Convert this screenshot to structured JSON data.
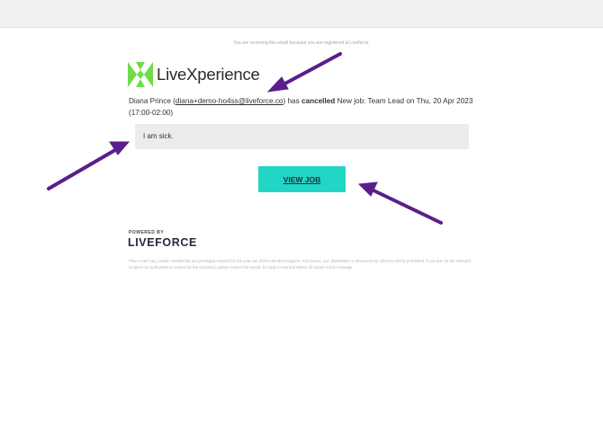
{
  "email": {
    "notice": "You are receiving this email because you are registered at Liveforce.",
    "logo_text": "LiveXperience",
    "message": {
      "name": "Diana Prince",
      "open_paren": " (",
      "email": "diana+demo-ho4ss@liveforce.co",
      "middle": ") has ",
      "action": "cancelled",
      "rest": " New job: Team Lead on Thu, 20 Apr 2023 (17:00-02:00)"
    },
    "reason": "I am sick.",
    "button_label": "VIEW JOB",
    "powered_by": "POWERED BY",
    "brand": "LIVEFORCE",
    "disclaimer": "This e-mail may contain confidential and privileged material for the sole use of the intended recipient. Any review, use, distribution or disclosure by others is strictly prohibited. If you are not the intended recipient (or authorised to receive for the recipient), please contact the sender by reply e-mail and delete all copies of this message."
  },
  "colors": {
    "accent": "#22d6c6",
    "logo_green": "#6fdc48",
    "arrow": "#5b1e8c"
  },
  "icons": [
    "livexperience-logo-icon"
  ]
}
